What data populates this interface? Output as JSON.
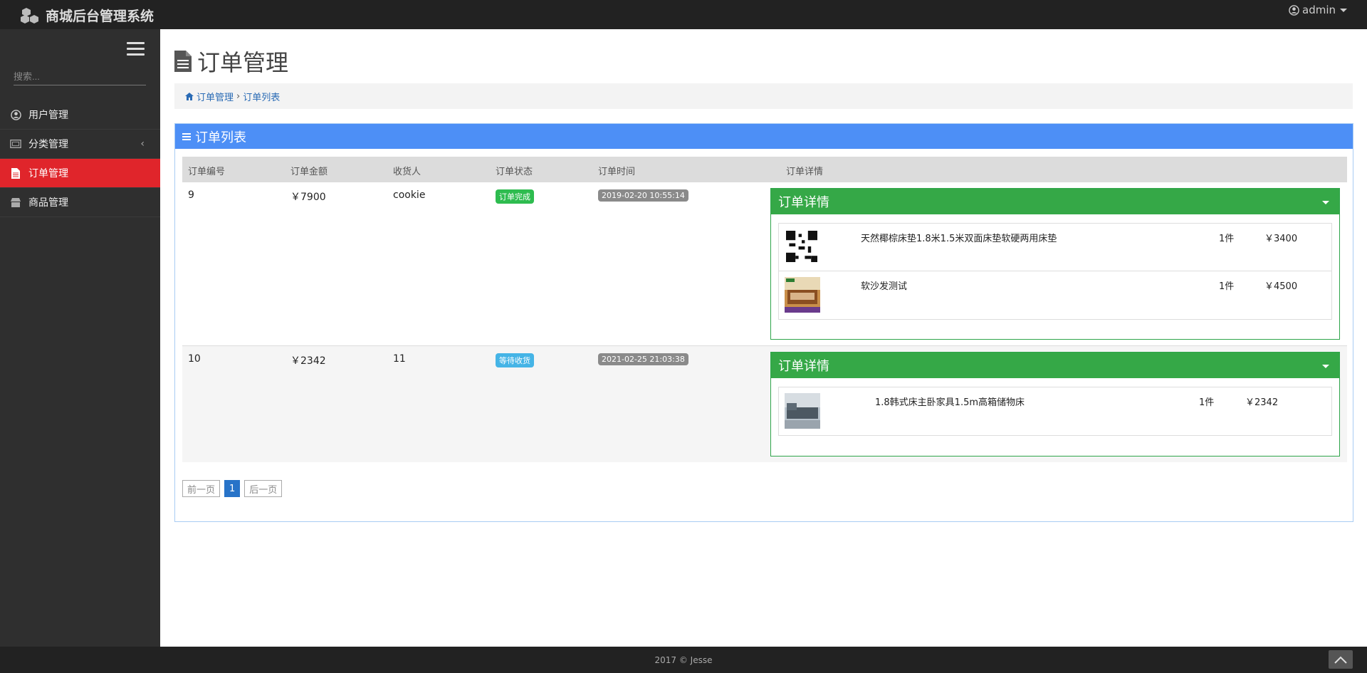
{
  "app": {
    "title": "商城后台管理系统",
    "user": "admin"
  },
  "sidebar": {
    "search_placeholder": "搜索...",
    "items": [
      {
        "label": "用户管理",
        "icon": "user-circle-icon"
      },
      {
        "label": "分类管理",
        "icon": "category-icon"
      },
      {
        "label": "订单管理",
        "icon": "file-icon",
        "active": true
      },
      {
        "label": "商品管理",
        "icon": "shop-icon"
      }
    ],
    "chevron": "‹"
  },
  "page": {
    "title": "订单管理",
    "breadcrumb": {
      "home": "订单管理",
      "sep": "›",
      "current": "订单列表"
    }
  },
  "panel": {
    "title": "订单列表",
    "columns": [
      "订单编号",
      "订单金额",
      "收货人",
      "订单状态",
      "订单时间",
      "订单详情"
    ],
    "orders": [
      {
        "id": "9",
        "amount": "￥7900",
        "receiver": "cookie",
        "status": "订单完成",
        "status_color": "#2ebc4f",
        "time": "2019-02-20 10:55:14",
        "detail_title": "订单详情",
        "items": [
          {
            "name": "天然椰棕床垫1.8米1.5米双面床垫软硬两用床垫",
            "qty": "1件",
            "price": "￥3400",
            "thumb": "qr-code"
          },
          {
            "name": "软沙发测试",
            "qty": "1件",
            "price": "￥4500",
            "thumb": "bed-photo"
          }
        ]
      },
      {
        "id": "10",
        "amount": "￥2342",
        "receiver": "11",
        "status": "等待收货",
        "status_color": "#45b4e6",
        "time": "2021-02-25 21:03:38",
        "detail_title": "订单详情",
        "items": [
          {
            "name": "1.8韩式床主卧家具1.5m高箱储物床",
            "qty": "1件",
            "price": "￥2342",
            "thumb": "sofa-photo"
          }
        ]
      }
    ],
    "pager": {
      "prev": "前一页",
      "current": "1",
      "next": "后一页"
    }
  },
  "footer": {
    "text": "2017 © Jesse"
  },
  "colors": {
    "topbar": "#222222",
    "sidebar": "#2f2f2f",
    "active": "#e0252b",
    "panel_head": "#4d8ff6",
    "detail_head": "#35a847"
  }
}
